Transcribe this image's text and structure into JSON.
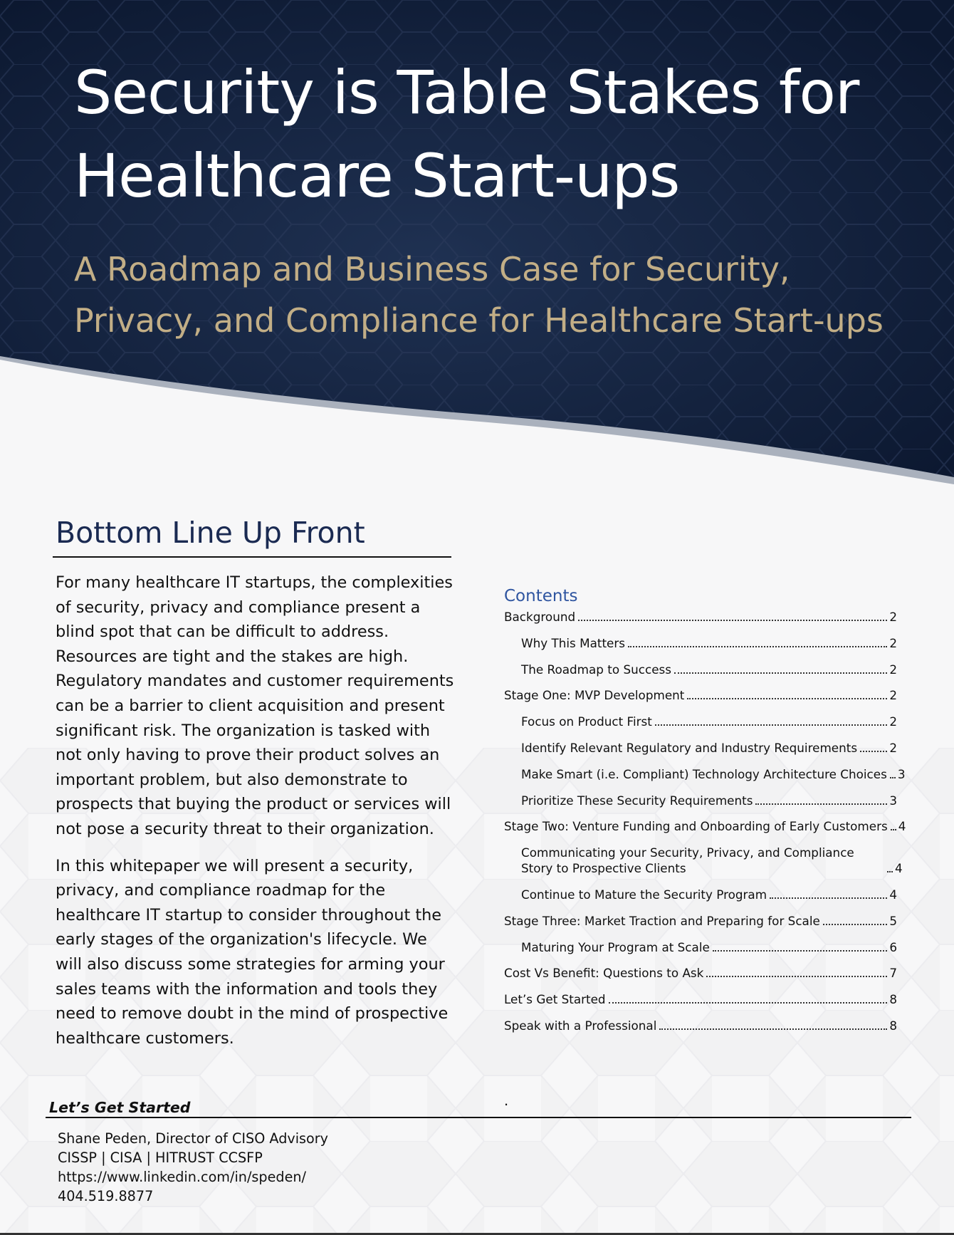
{
  "title": {
    "line1": "Security is Table Stakes for",
    "line2": "Healthcare Start-ups"
  },
  "subtitle": {
    "line1": "A Roadmap and Business Case for Security,",
    "line2": "Privacy, and Compliance for Healthcare Start-ups"
  },
  "bluf": {
    "heading": "Bottom Line Up Front",
    "paragraph1": "For many healthcare IT startups, the complexities of security, privacy and compliance present a blind spot that can be difficult to address.  Resources are tight and the stakes are high. Regulatory mandates and customer requirements can be a barrier to client acquisition and present significant risk. The organization is tasked with not only having to prove their product solves an important problem, but also demonstrate to prospects that buying the product or services will not pose a security threat to their organization.",
    "paragraph2": "In this whitepaper we will present a security, privacy, and compliance roadmap for the healthcare IT startup to consider throughout the early stages of the organization's lifecycle.  We will also discuss some strategies for arming your sales teams with the information and tools they need to remove doubt in the mind of prospective healthcare customers."
  },
  "toc": {
    "heading": "Contents",
    "entries": [
      {
        "label": "Background",
        "page": "2"
      },
      {
        "label": "Why This Matters",
        "page": "2"
      },
      {
        "label": "The Roadmap to Success",
        "page": "2"
      },
      {
        "label": "Stage One: MVP Development",
        "page": "2"
      },
      {
        "label": "Focus on Product First",
        "page": "2"
      },
      {
        "label": "Identify Relevant Regulatory and Industry Requirements",
        "page": "2"
      },
      {
        "label": "Make Smart (i.e. Compliant) Technology Architecture Choices",
        "page": "3"
      },
      {
        "label": "Prioritize These Security Requirements",
        "page": "3"
      },
      {
        "label": "Stage Two: Venture Funding and Onboarding of Early Customers",
        "page": "4"
      },
      {
        "label": "Communicating your Security, Privacy, and Compliance Story to Prospective Clients",
        "page": "4"
      },
      {
        "label": "Continue to Mature the Security Program",
        "page": "4"
      },
      {
        "label": "Stage Three: Market Traction and Preparing for Scale",
        "page": "5"
      },
      {
        "label": "Maturing Your Program at Scale",
        "page": "6"
      },
      {
        "label": "Cost Vs Benefit: Questions to Ask",
        "page": "7"
      },
      {
        "label": "Let’s Get Started",
        "page": "8"
      },
      {
        "label": "Speak with a Professional",
        "page": "8"
      }
    ]
  },
  "footer": {
    "section_label": "Let’s Get Started",
    "stray_mark": ".",
    "contact": {
      "name_title": "Shane Peden, Director of CISO Advisory",
      "credentials": "CISSP | CISA | HITRUST CCSFP",
      "linkedin": "https://www.linkedin.com/in/speden/",
      "phone": "404.519.8877"
    }
  },
  "colors": {
    "header_navy": "#13213b",
    "subtitle_gold": "#c2ae86",
    "heading_navy": "#1a2a52",
    "toc_heading_blue": "#2f55a0"
  }
}
